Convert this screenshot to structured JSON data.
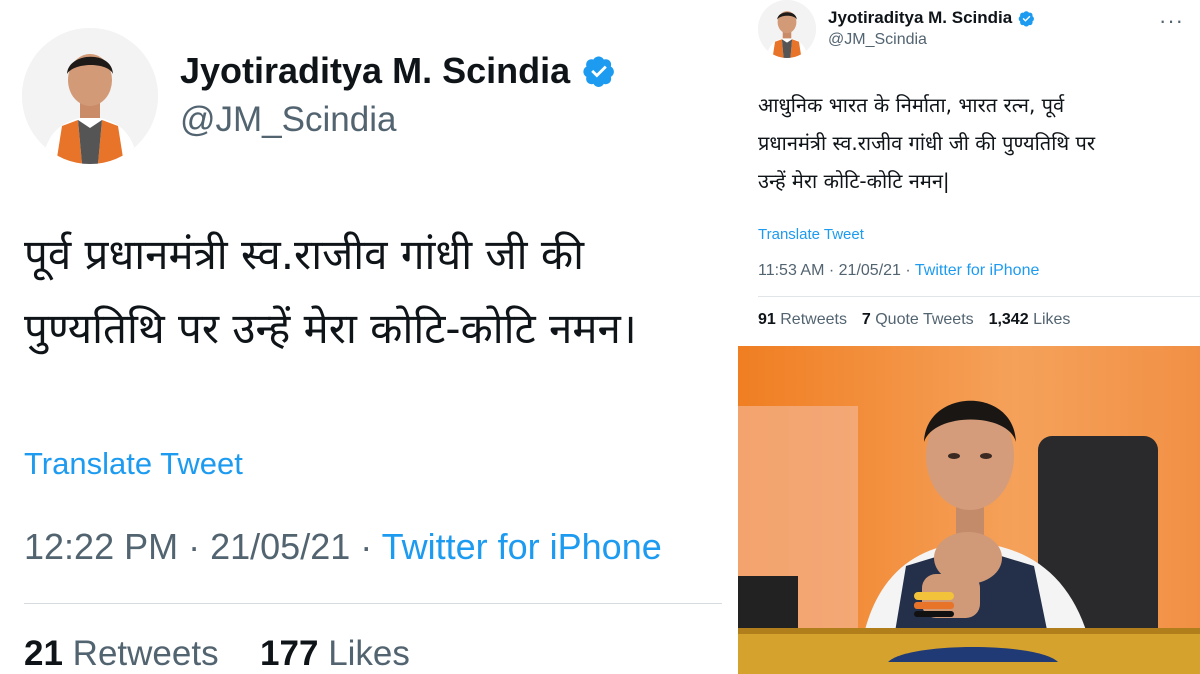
{
  "left_tweet": {
    "author_name": "Jyotiraditya M. Scindia",
    "handle": "@JM_Scindia",
    "text_lines": [
      "पूर्व प्रधानमंत्री स्व.राजीव गांधी जी की",
      "पुण्यतिथि पर उन्हें मेरा कोटि-कोटि नमन।"
    ],
    "translate_label": "Translate Tweet",
    "time": "12:22 PM",
    "date": "21/05/21",
    "source": "Twitter for iPhone",
    "retweets_count": "21",
    "retweets_label": "Retweets",
    "likes_count": "177",
    "likes_label": "Likes"
  },
  "right_tweet": {
    "author_name": "Jyotiraditya M. Scindia",
    "handle": "@JM_Scindia",
    "text_lines": [
      "आधुनिक भारत के निर्माता, भारत रत्न, पूर्व",
      "प्रधानमंत्री स्व.राजीव गांधी जी की पुण्यतिथि पर",
      "उन्हें मेरा कोटि-कोटि नमन|"
    ],
    "translate_label": "Translate Tweet",
    "time": "11:53 AM",
    "date": "21/05/21",
    "source": "Twitter for iPhone",
    "retweets_count": "91",
    "retweets_label": "Retweets",
    "quote_count": "7",
    "quote_label": "Quote Tweets",
    "likes_count": "1,342",
    "likes_label": "Likes"
  },
  "icons": {
    "verified": "verified-badge-icon",
    "more": "more-options-icon"
  },
  "colors": {
    "link_blue": "#1d9bf0",
    "muted_gray": "#536471",
    "saffron": "#f08a24"
  }
}
